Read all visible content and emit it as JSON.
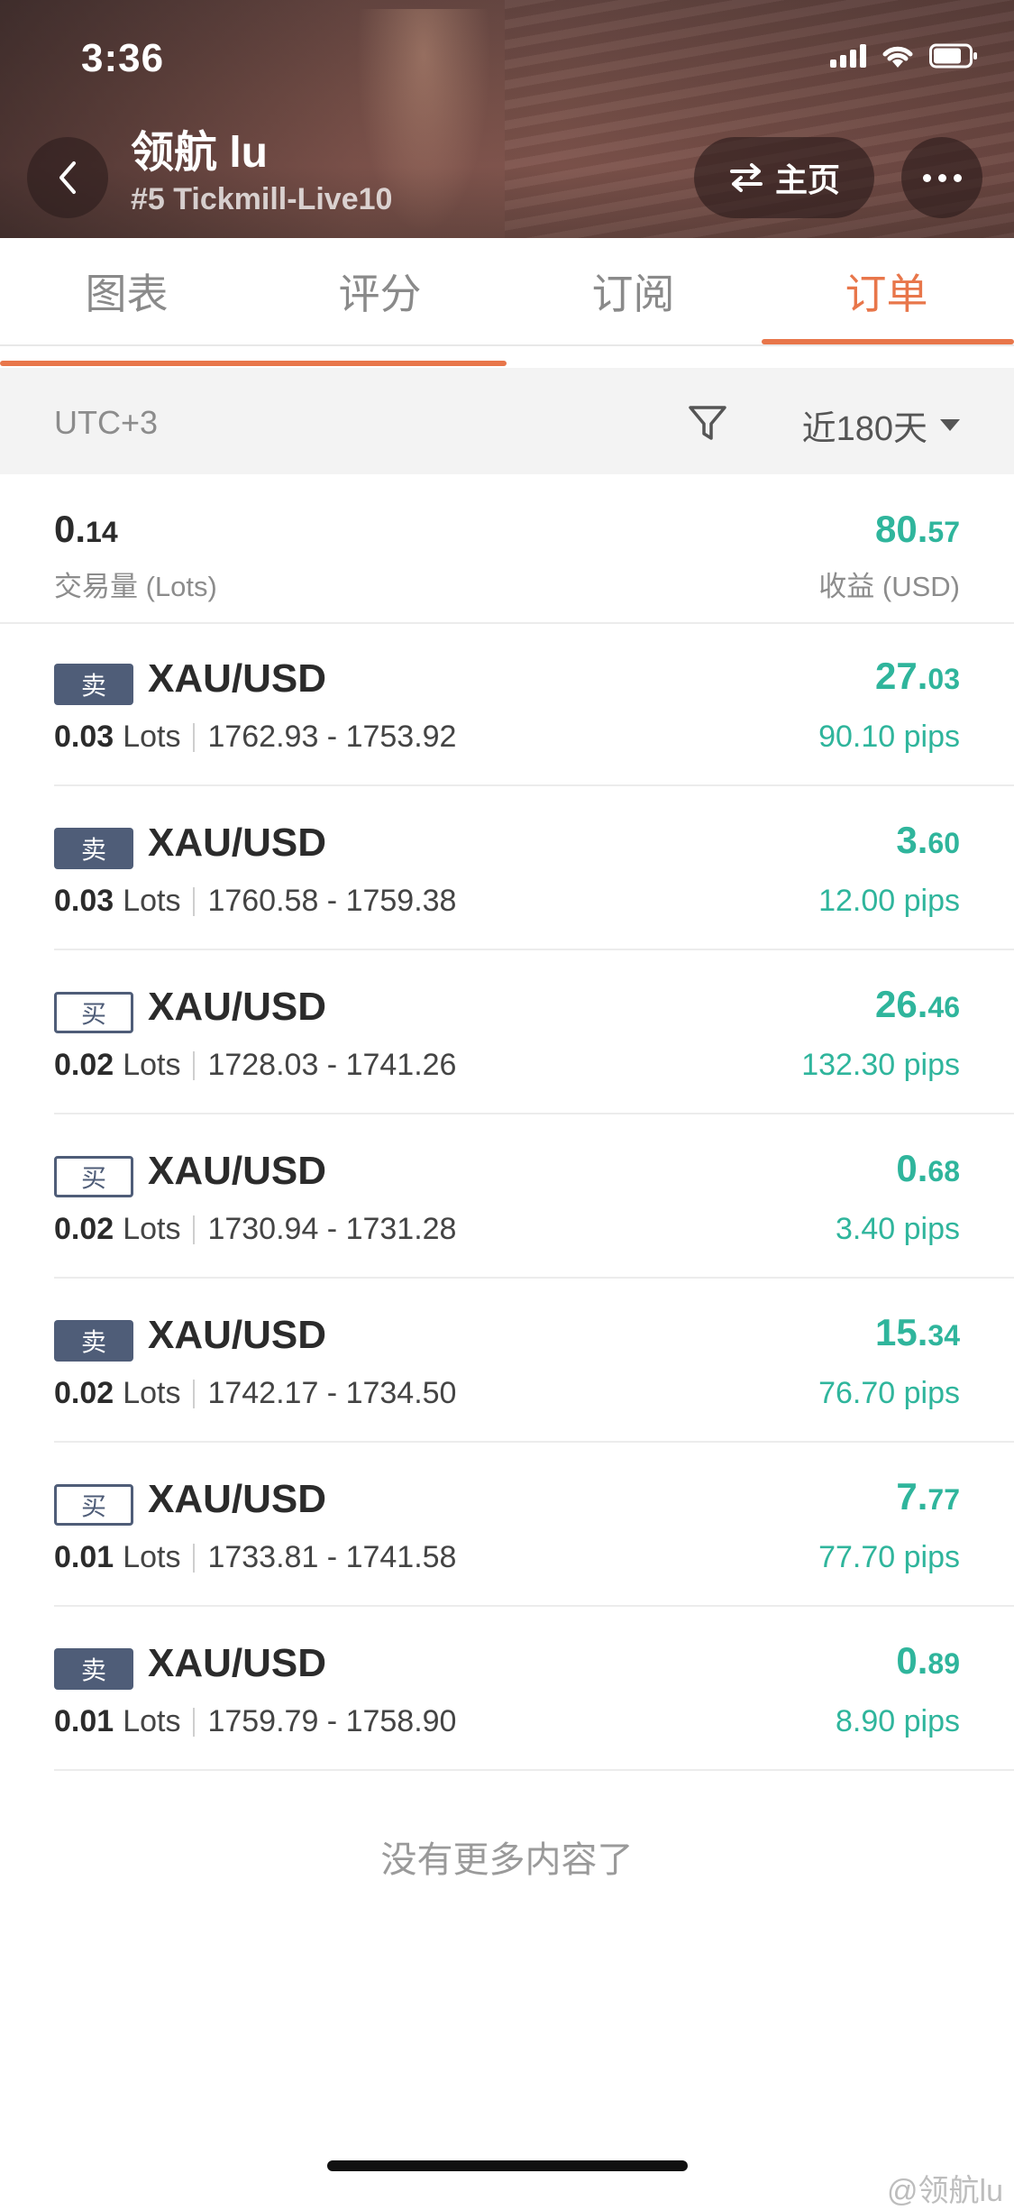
{
  "status": {
    "time": "3:36"
  },
  "header": {
    "title": "领航 lu",
    "subtitle": "#5 Tickmill-Live10",
    "home_label": "主页"
  },
  "tabs": [
    {
      "label": "图表",
      "active": false
    },
    {
      "label": "评分",
      "active": false
    },
    {
      "label": "订阅",
      "active": false
    },
    {
      "label": "订单",
      "active": true
    }
  ],
  "filter": {
    "timezone": "UTC+3",
    "range": "近180天"
  },
  "summary": {
    "volume_int": "0.",
    "volume_dec": "14",
    "volume_label": "交易量 (Lots)",
    "profit_int": "80.",
    "profit_dec": "57",
    "profit_label": "收益 (USD)"
  },
  "orders": [
    {
      "side": "卖",
      "type": "sell",
      "symbol": "XAU/USD",
      "lots": "0.03",
      "lots_unit": "Lots",
      "prices": "1762.93 - 1753.92",
      "profit_int": "27.",
      "profit_dec": "03",
      "pips": "90.10 pips"
    },
    {
      "side": "卖",
      "type": "sell",
      "symbol": "XAU/USD",
      "lots": "0.03",
      "lots_unit": "Lots",
      "prices": "1760.58 - 1759.38",
      "profit_int": "3.",
      "profit_dec": "60",
      "pips": "12.00 pips"
    },
    {
      "side": "买",
      "type": "buy",
      "symbol": "XAU/USD",
      "lots": "0.02",
      "lots_unit": "Lots",
      "prices": "1728.03 - 1741.26",
      "profit_int": "26.",
      "profit_dec": "46",
      "pips": "132.30 pips"
    },
    {
      "side": "买",
      "type": "buy",
      "symbol": "XAU/USD",
      "lots": "0.02",
      "lots_unit": "Lots",
      "prices": "1730.94 - 1731.28",
      "profit_int": "0.",
      "profit_dec": "68",
      "pips": "3.40 pips"
    },
    {
      "side": "卖",
      "type": "sell",
      "symbol": "XAU/USD",
      "lots": "0.02",
      "lots_unit": "Lots",
      "prices": "1742.17 - 1734.50",
      "profit_int": "15.",
      "profit_dec": "34",
      "pips": "76.70 pips"
    },
    {
      "side": "买",
      "type": "buy",
      "symbol": "XAU/USD",
      "lots": "0.01",
      "lots_unit": "Lots",
      "prices": "1733.81 - 1741.58",
      "profit_int": "7.",
      "profit_dec": "77",
      "pips": "77.70 pips"
    },
    {
      "side": "卖",
      "type": "sell",
      "symbol": "XAU/USD",
      "lots": "0.01",
      "lots_unit": "Lots",
      "prices": "1759.79 - 1758.90",
      "profit_int": "0.",
      "profit_dec": "89",
      "pips": "8.90 pips"
    }
  ],
  "footer": {
    "no_more": "没有更多内容了"
  },
  "watermark": "@领航lu",
  "colors": {
    "accent": "#e8764a",
    "profit": "#2fb59c",
    "badge": "#4f5d78"
  }
}
